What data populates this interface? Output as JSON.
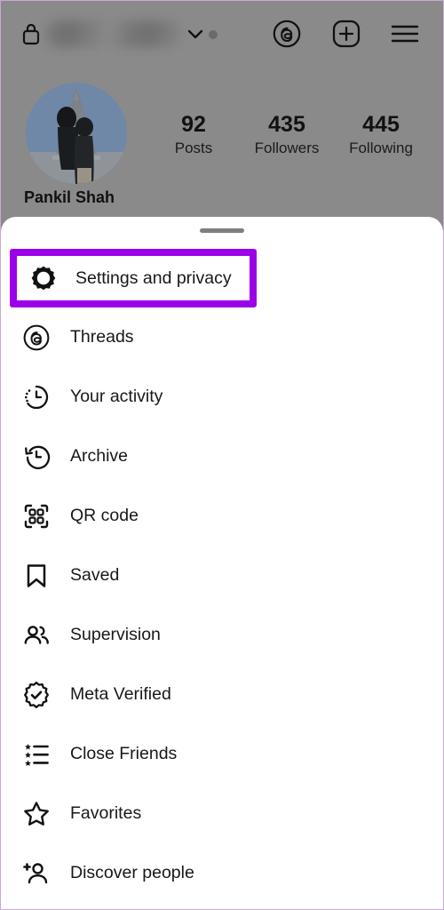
{
  "app": "Instagram profile with account menu sheet",
  "header": {
    "lock_icon": "lock-icon",
    "username_masked": "",
    "chevron_icon": "chevron-down-icon",
    "activity_dot": "dot-indicator",
    "threads_icon": "threads-icon",
    "new_post_icon": "plus-square-icon",
    "menu_icon": "hamburger-menu-icon"
  },
  "profile": {
    "display_name": "Pankil Shah",
    "avatar_alt": "profile-photo",
    "stats": [
      {
        "value": "92",
        "label": "Posts"
      },
      {
        "value": "435",
        "label": "Followers"
      },
      {
        "value": "445",
        "label": "Following"
      }
    ]
  },
  "sheet": {
    "handle": "drag-handle",
    "highlight_color": "#9b00e8",
    "items": [
      {
        "label": "Settings and privacy",
        "icon": "gear-icon",
        "highlighted": true
      },
      {
        "label": "Threads",
        "icon": "threads-icon",
        "highlighted": false
      },
      {
        "label": "Your activity",
        "icon": "activity-clock-icon",
        "highlighted": false
      },
      {
        "label": "Archive",
        "icon": "archive-clock-icon",
        "highlighted": false
      },
      {
        "label": "QR code",
        "icon": "qr-code-icon",
        "highlighted": false
      },
      {
        "label": "Saved",
        "icon": "bookmark-icon",
        "highlighted": false
      },
      {
        "label": "Supervision",
        "icon": "people-icon",
        "highlighted": false
      },
      {
        "label": "Meta Verified",
        "icon": "verified-badge-icon",
        "highlighted": false
      },
      {
        "label": "Close Friends",
        "icon": "star-list-icon",
        "highlighted": false
      },
      {
        "label": "Favorites",
        "icon": "star-icon",
        "highlighted": false
      },
      {
        "label": "Discover people",
        "icon": "person-add-icon",
        "highlighted": false
      }
    ]
  }
}
